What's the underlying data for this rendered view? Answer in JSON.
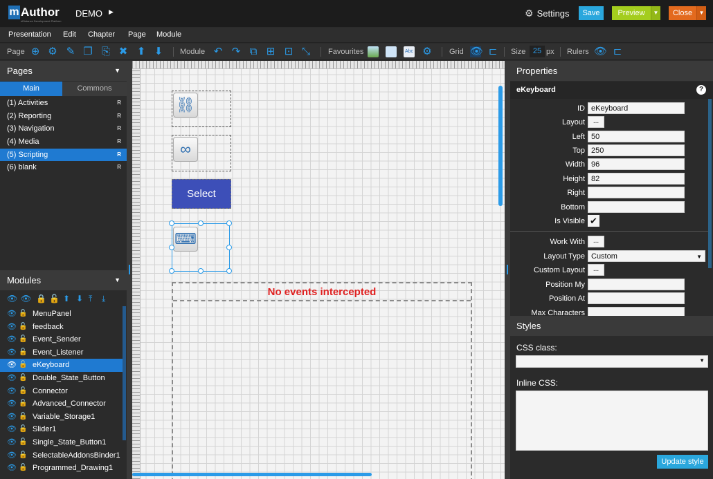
{
  "app": {
    "logo_mark": "m",
    "logo_text": "Author",
    "logo_sub": "eDistance Development Platform",
    "project": "DEMO"
  },
  "topbar": {
    "settings_label": "Settings",
    "save_label": "Save",
    "preview_label": "Preview",
    "close_label": "Close"
  },
  "menu": [
    "Presentation",
    "Edit",
    "Chapter",
    "Page",
    "Module"
  ],
  "toolbar": {
    "page_label": "Page",
    "module_label": "Module",
    "favourites_label": "Favourites",
    "grid_label": "Grid",
    "size_label": "Size",
    "size_value": "25",
    "size_unit": "px",
    "rulers_label": "Rulers"
  },
  "pages_panel": {
    "title": "Pages",
    "tabs": [
      "Main",
      "Commons"
    ],
    "items": [
      {
        "label": "(1) Activities",
        "badge": "R"
      },
      {
        "label": "(2) Reporting",
        "badge": "R"
      },
      {
        "label": "(3) Navigation",
        "badge": "R"
      },
      {
        "label": "(4) Media",
        "badge": "R"
      },
      {
        "label": "(5) Scripting",
        "badge": "R",
        "active": true
      },
      {
        "label": "(6) blank",
        "badge": "R"
      }
    ]
  },
  "modules_panel": {
    "title": "Modules",
    "items": [
      "MenuPanel",
      "feedback",
      "Event_Sender",
      "Event_Listener",
      "eKeyboard",
      "Double_State_Button",
      "Connector",
      "Advanced_Connector",
      "Variable_Storage1",
      "Slider1",
      "Single_State_Button1",
      "SelectableAddonsBinder1",
      "Programmed_Drawing1"
    ],
    "active": "eKeyboard"
  },
  "canvas": {
    "select_label": "Select",
    "events_text": "No events intercepted"
  },
  "properties": {
    "title": "Properties",
    "module_name": "eKeyboard",
    "help_glyph": "?",
    "fields": {
      "id": {
        "label": "ID",
        "value": "eKeyboard"
      },
      "layout": {
        "label": "Layout",
        "value": "..."
      },
      "left": {
        "label": "Left",
        "value": "50"
      },
      "top": {
        "label": "Top",
        "value": "250"
      },
      "width": {
        "label": "Width",
        "value": "96"
      },
      "height": {
        "label": "Height",
        "value": "82"
      },
      "right": {
        "label": "Right",
        "value": ""
      },
      "bottom": {
        "label": "Bottom",
        "value": ""
      },
      "is_visible": {
        "label": "Is Visible",
        "value": "✔"
      },
      "work_with": {
        "label": "Work With",
        "value": "..."
      },
      "layout_type": {
        "label": "Layout Type",
        "value": "Custom"
      },
      "custom_layout": {
        "label": "Custom Layout",
        "value": "..."
      },
      "position_my": {
        "label": "Position My",
        "value": ""
      },
      "position_at": {
        "label": "Position At",
        "value": ""
      },
      "max_characters": {
        "label": "Max Characters",
        "value": ""
      }
    }
  },
  "styles": {
    "title": "Styles",
    "css_class_label": "CSS class:",
    "css_class_value": "",
    "inline_css_label": "Inline CSS:",
    "inline_css_value": "",
    "update_label": "Update style"
  },
  "colors": {
    "accent": "#1f7ad1",
    "icon_blue": "#2b9be8",
    "save": "#2aa7dd",
    "preview": "#a4cd1e",
    "close": "#e36a1e",
    "select_button": "#3d4fb8",
    "events_text": "#e02020"
  }
}
